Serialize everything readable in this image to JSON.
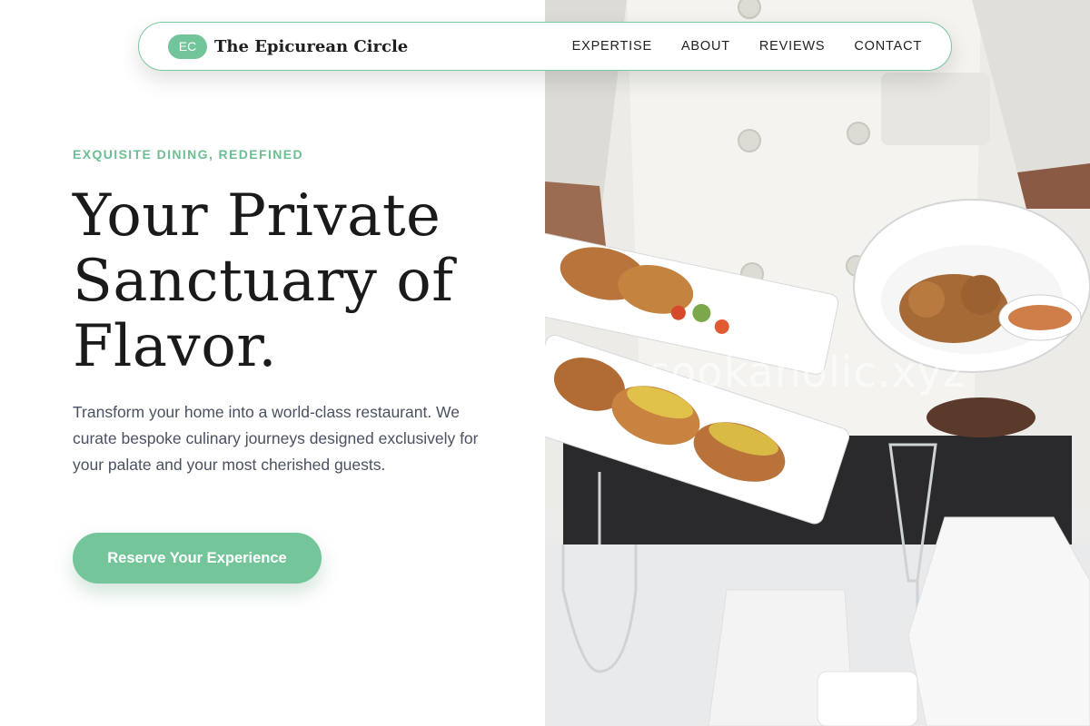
{
  "brand": {
    "badge": "EC",
    "name": "The Epicurean Circle"
  },
  "nav": {
    "items": [
      {
        "label": "EXPERTISE"
      },
      {
        "label": "ABOUT"
      },
      {
        "label": "REVIEWS"
      },
      {
        "label": "CONTACT"
      }
    ]
  },
  "hero": {
    "eyebrow": "EXQUISITE DINING, REDEFINED",
    "headline": [
      "Your Private",
      "Sanctuary of",
      "Flavor."
    ],
    "lead": "Transform your home into a world-class restaurant. We curate bespoke culinary journeys designed exclusively for your palate and your most cherished guests.",
    "cta_label": "Reserve Your Experience"
  },
  "image": {
    "watermark": "cookaholic.xyz"
  },
  "colors": {
    "accent": "#72c49a",
    "heading": "#1a1a1a",
    "body": "#4a5160"
  }
}
